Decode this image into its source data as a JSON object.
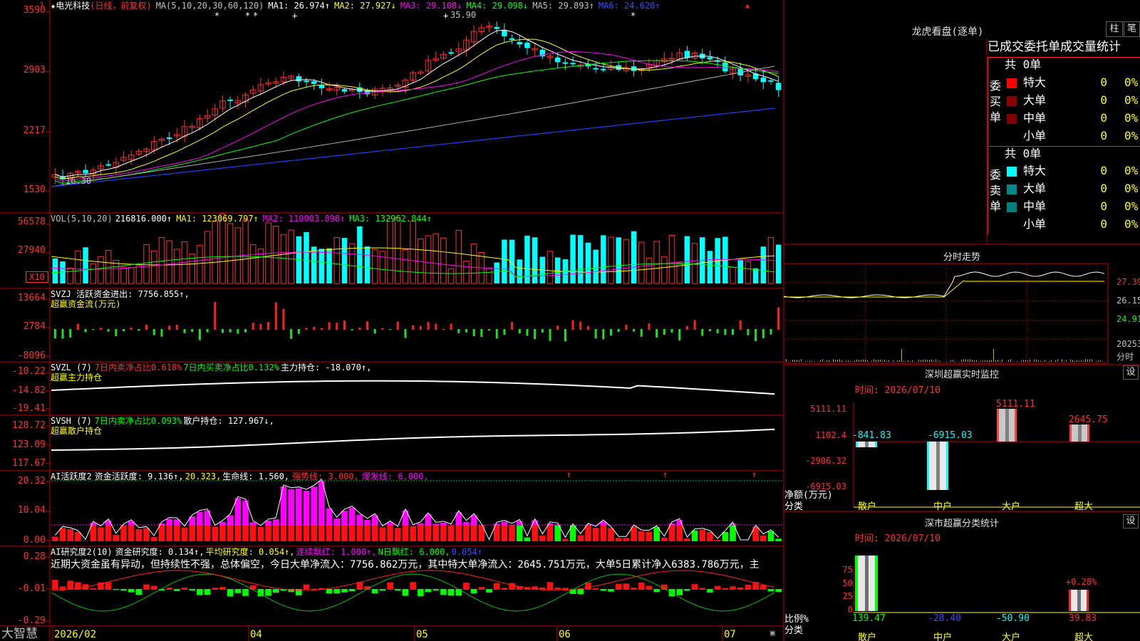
{
  "app": {
    "brand": "大智慧"
  },
  "main_chart": {
    "stock_name": "★电光科技",
    "mode": "(日线，前复权)",
    "ma_label": "MA(5,10,20,30,60,120)",
    "ma_items": [
      {
        "t": "MA1: 26.974↑",
        "c": "#ffffff"
      },
      {
        "t": "MA2: 27.927↓",
        "c": "#ffff00"
      },
      {
        "t": "MA3: 29.108↓",
        "c": "#ff00ff"
      },
      {
        "t": "MA4: 29.098↓",
        "c": "#00ff00"
      },
      {
        "t": "MA5: 29.893↑",
        "c": "#c0c0c0"
      },
      {
        "t": "MA6: 24.620↑",
        "c": "#3050ff"
      }
    ],
    "high_label": "35.90",
    "low_label": "16.30",
    "y_labels": [
      "3590",
      "2903",
      "2217",
      "1530"
    ]
  },
  "volume": {
    "title": "VOL(5,10,20)",
    "value": "216816.000↑",
    "items": [
      {
        "t": "MA1: 123069.797↑",
        "c": "#ffff00"
      },
      {
        "t": "MA2: 110003.898↑",
        "c": "#ff00ff"
      },
      {
        "t": "MA3: 132962.844↑",
        "c": "#00ff00"
      }
    ],
    "y_labels": [
      "56578",
      "27940"
    ],
    "unit": "X10"
  },
  "svzj": {
    "title": "SVZJ  活跃资金进出: 7756.855↑,",
    "subtitle": "超赢资金流(万元)",
    "y_labels": [
      "13664",
      "2784",
      "-8096"
    ]
  },
  "svzl": {
    "title": "SVZL (7)",
    "i1": "7日内卖净占比0.618%",
    "i2": "7日内买卖净占比0.132%",
    "i3": "主力持仓: -18.070↑,",
    "subtitle": "超赢主力持仓",
    "y_labels": [
      "-10.22",
      "-14.82",
      "-19.41"
    ]
  },
  "svsh": {
    "title": "SVSH (7)",
    "i1": "7日内卖净占比0.093%",
    "i2": "散户持仓: 127.967↓,",
    "subtitle": "超赢散户持仓",
    "y_labels": [
      "128.72",
      "123.09",
      "117.67"
    ]
  },
  "ai_active": {
    "title": "AI活跃度2",
    "i1": "资金活跃度: 9.136↑,",
    "i2": "20.323,",
    "i3": "生命线: 1.560,",
    "i4": "强势线: 3.000,",
    "i5": "爆发线: 6.000,",
    "y_labels": [
      "20.32",
      "10.04",
      "0.00"
    ]
  },
  "ai_research": {
    "title": "AI研究度2(10)",
    "i1": "资金研究度: 0.134↑,",
    "i2": "平均研究度: 0.054↑,",
    "i3": "连续飘红: 1.000↑,",
    "i4": "N日飘红: 6.000,",
    "i5": "0.054↑",
    "text": "近期大资金虽有异动，但持续性不强，总体偏空，今日大单净流入：7756.862万元，其中特大单净流入：2645.751万元，大单5日累计净入6383.786万元，主",
    "y_labels": [
      "0.28",
      "-0.01",
      "-0.29"
    ]
  },
  "x_axis": [
    "2026/02",
    "04",
    "05",
    "06",
    "07"
  ],
  "dragon": {
    "title": "龙虎看盘(逐单)",
    "btn1": "柱",
    "btn2": "笔",
    "heading": "已成交委托单成交量统计",
    "buy": {
      "label": "委买单",
      "total": "共 0单",
      "rows": [
        {
          "name": "特大",
          "v": "0",
          "p": "0%",
          "c": "#ff0000"
        },
        {
          "name": "大单",
          "v": "0",
          "p": "0%",
          "c": "#8b0000"
        },
        {
          "name": "中单",
          "v": "0",
          "p": "0%",
          "c": "#800000"
        },
        {
          "name": "小单",
          "v": "0",
          "p": "0%",
          "c": ""
        }
      ]
    },
    "sell": {
      "label": "委卖单",
      "total": "共 0单",
      "rows": [
        {
          "name": "特大",
          "v": "0",
          "p": "0%",
          "c": "#00ffff"
        },
        {
          "name": "大单",
          "v": "0",
          "p": "0%",
          "c": "#008b8b"
        },
        {
          "name": "中单",
          "v": "0",
          "p": "0%",
          "c": "#008080"
        },
        {
          "name": "小单",
          "v": "0",
          "p": "0%",
          "c": ""
        }
      ]
    }
  },
  "intraday": {
    "title": "分时走势",
    "labels": [
      "27.39",
      "26.15",
      "24.91",
      "20253",
      "分时"
    ]
  },
  "sz_monitor": {
    "title": "深圳超赢实时监控",
    "btn": "设",
    "time": "时间: 2026/07/10",
    "y_labels": [
      "5111.11",
      "1102.4",
      "-2906.32",
      "-6915.03"
    ],
    "ylabel": "净额(万元)",
    "xlabel": "分类",
    "cats": [
      "散户",
      "中户",
      "大户",
      "超大"
    ],
    "values": [
      "-841.83",
      "-6915.03",
      "5111.11",
      "2645.75"
    ]
  },
  "sz_class": {
    "title": "深市超赢分类统计",
    "btn": "设",
    "time": "时间: 2026/07/10",
    "y_labels": [
      "75",
      "50",
      "25",
      "0"
    ],
    "ylabel": "比例%",
    "xlabel": "分类",
    "cats": [
      "散户",
      "中户",
      "大户",
      "超大"
    ],
    "values": [
      "139.47",
      "-28.40",
      "-50.90",
      "39.83"
    ],
    "annot": "+0.28%"
  }
}
